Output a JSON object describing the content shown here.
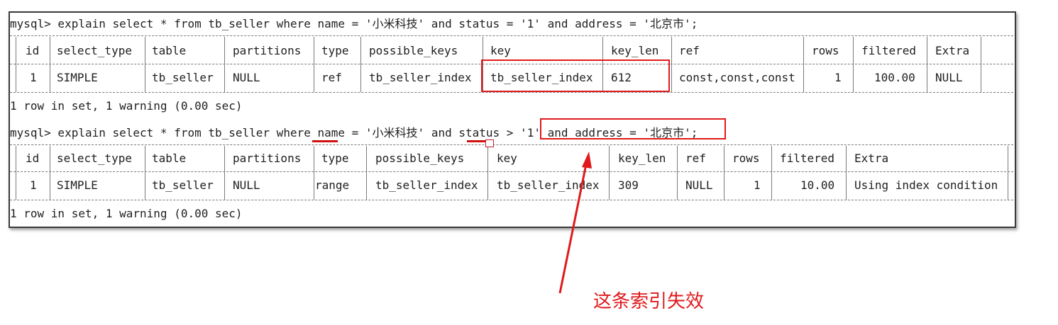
{
  "query1": {
    "prompt": "mysql> explain select * from tb_seller where name = '小米科技' and status = '1' and address = '北京市';",
    "headers": [
      "id",
      "select_type",
      "table",
      "partitions",
      "type",
      "possible_keys",
      "key",
      "key_len",
      "ref",
      "rows",
      "filtered",
      "Extra"
    ],
    "row": [
      "1",
      "SIMPLE",
      "tb_seller",
      "NULL",
      "ref",
      "tb_seller_index",
      "tb_seller_index",
      "612",
      "const,const,const",
      "1",
      "100.00",
      "NULL"
    ],
    "footer": "1 row in set, 1 warning (0.00 sec)"
  },
  "query2": {
    "prompt_prefix": "mysql> explain select * from tb_seller where ",
    "name_word": "name",
    "mid1": " = '小米科技' and ",
    "status_word": "status",
    "mid2": " > '1'",
    "highlight": " and address = '北京市';",
    "headers": [
      "id",
      "select_type",
      "table",
      "partitions",
      "type",
      "possible_keys",
      "key",
      "key_len",
      "ref",
      "rows",
      "filtered",
      "Extra"
    ],
    "row": [
      "1",
      "SIMPLE",
      "tb_seller",
      "NULL",
      "range",
      "tb_seller_index",
      "tb_seller_index",
      "309",
      "NULL",
      "1",
      "10.00",
      "Using index condition"
    ],
    "footer": "1 row in set, 1 warning (0.00 sec)"
  },
  "annotation": "这条索引失效",
  "colors": {
    "accent_red": "#e0191b",
    "text": "#1f1f1f",
    "border": "#3a3a3a"
  },
  "icons": [
    "mouse-cursor-icon",
    "annotation-arrow-icon"
  ]
}
